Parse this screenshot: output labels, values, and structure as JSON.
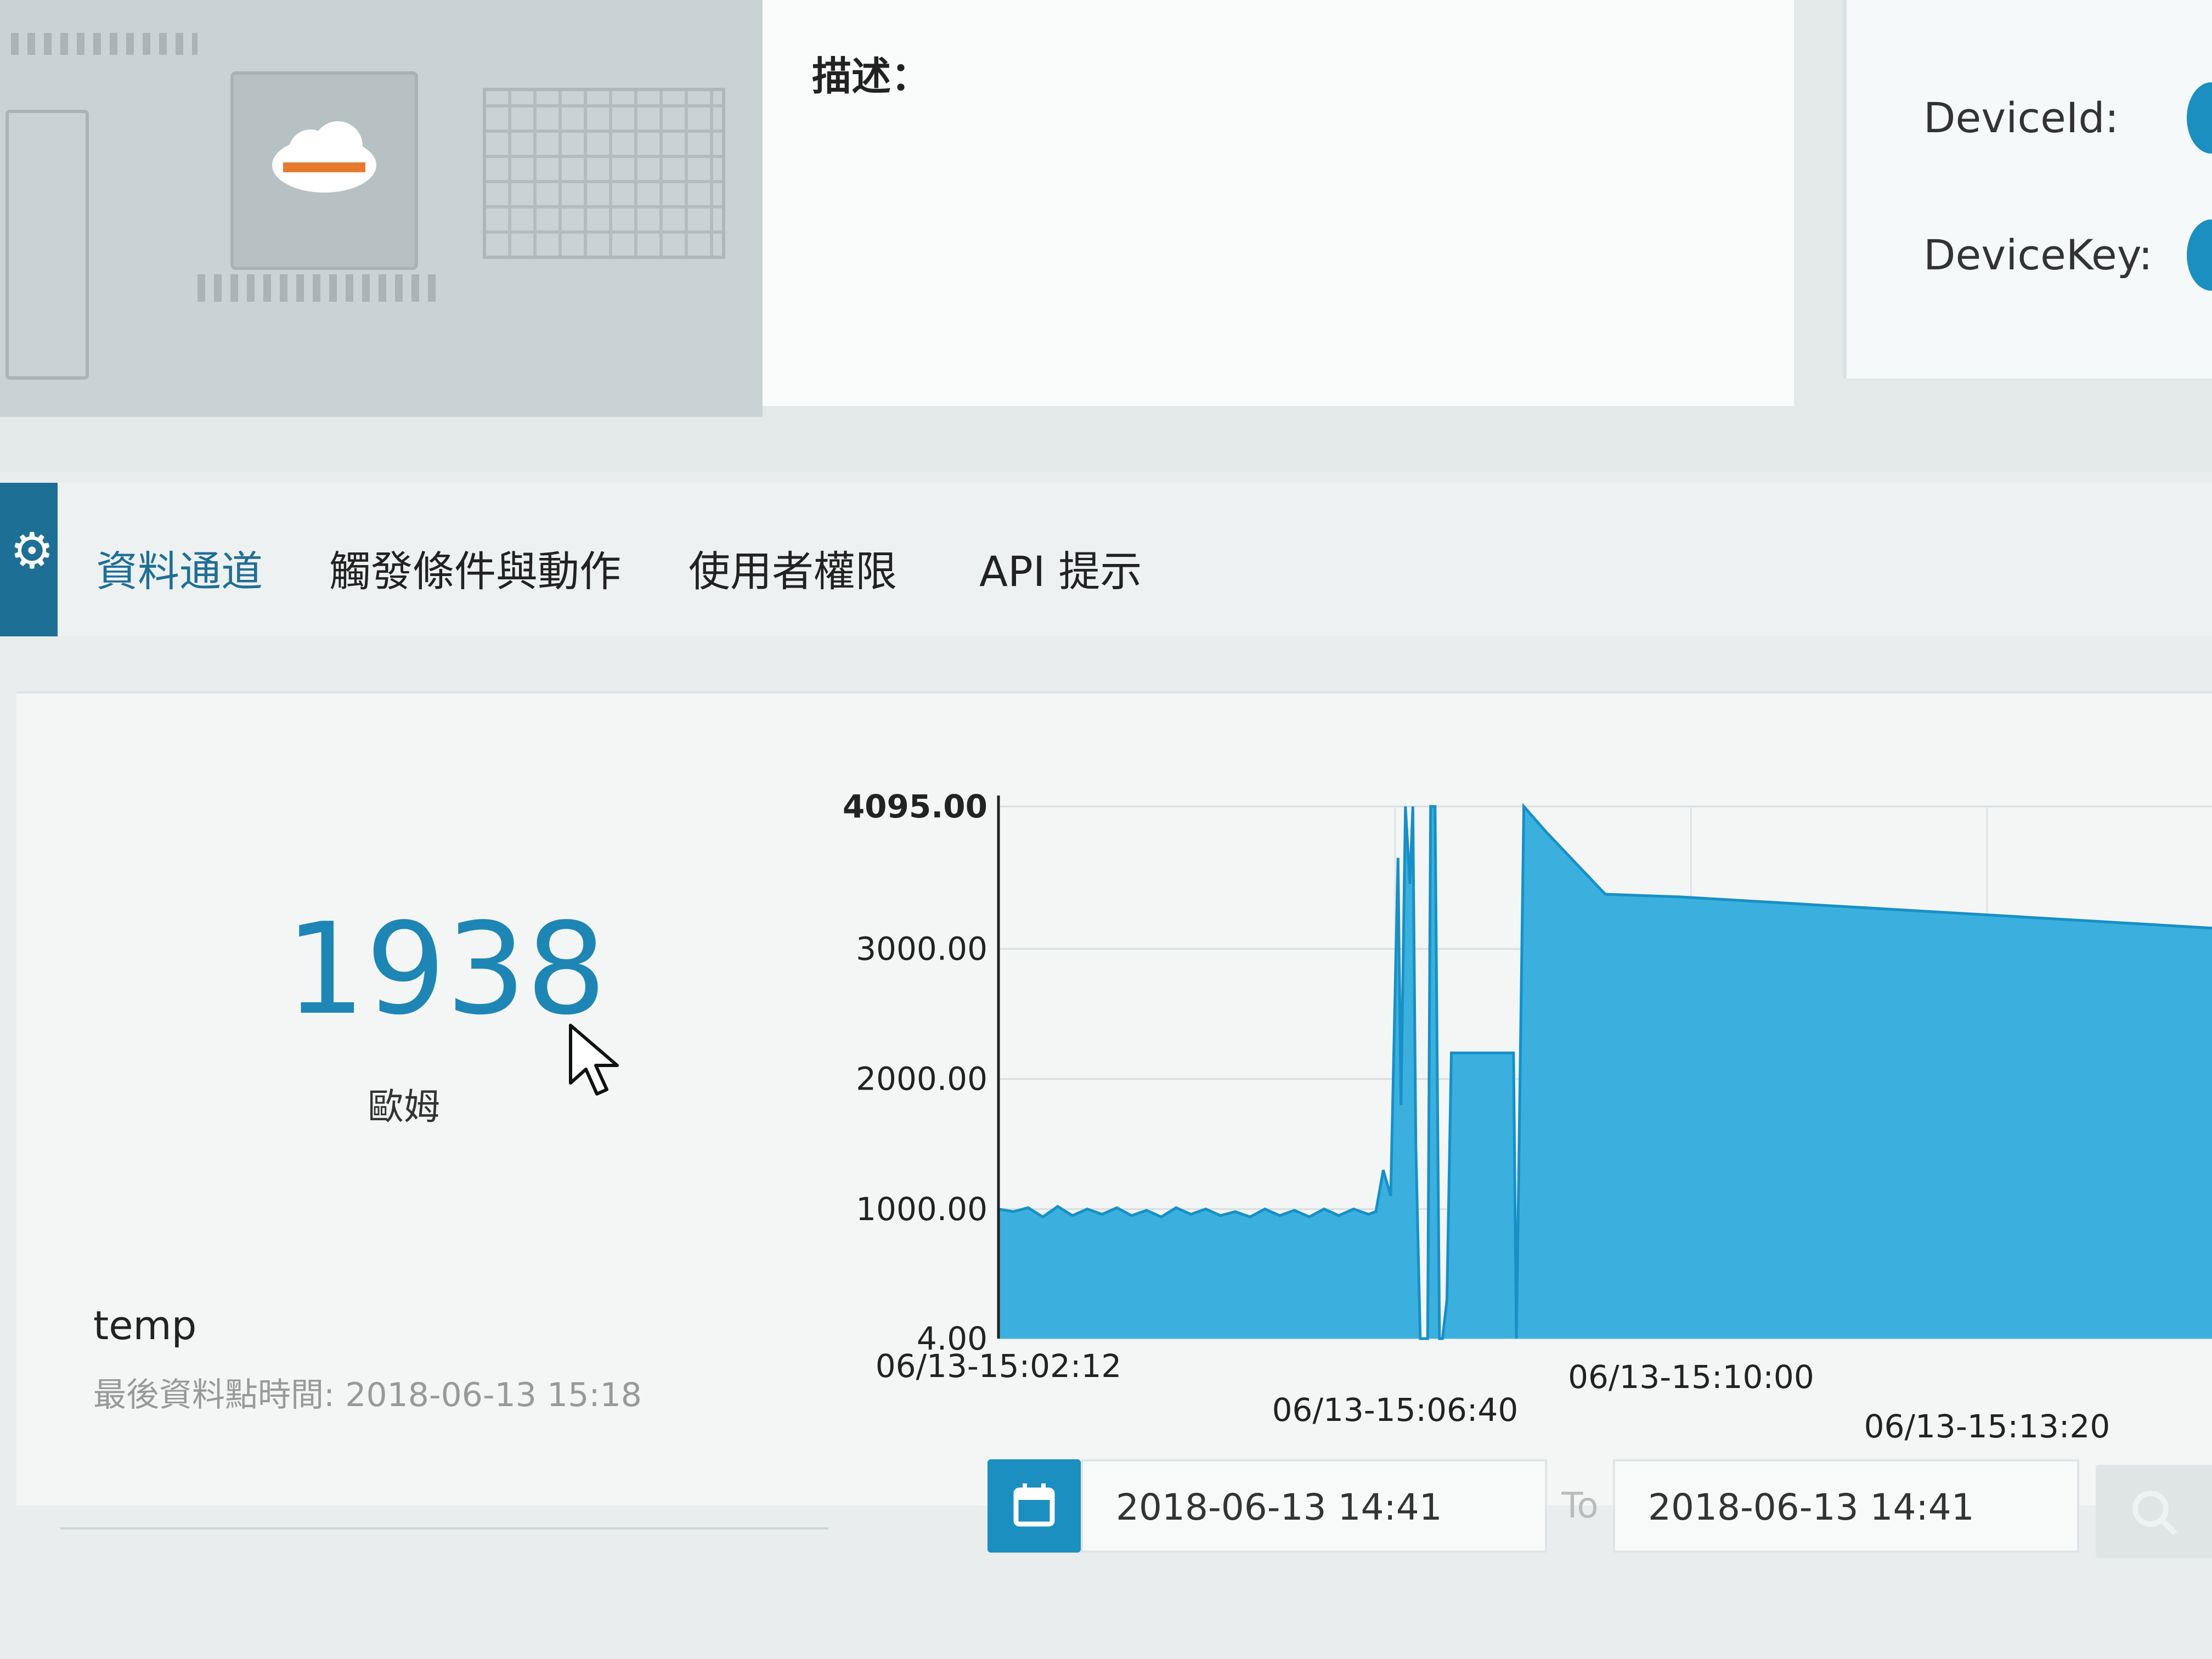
{
  "header": {
    "description_label": "描述：",
    "device_id_label": "DeviceId:",
    "device_key_label": "DeviceKey:"
  },
  "tabs": [
    {
      "label": "資料通道",
      "active": true
    },
    {
      "label": "觸發條件與動作",
      "active": false
    },
    {
      "label": "使用者權限",
      "active": false
    },
    {
      "label": "API 提示",
      "active": false
    }
  ],
  "channel": {
    "value": "1938",
    "unit": "歐姆",
    "name": "temp",
    "last_time": "最後資料點時間: 2018-06-13 15:18"
  },
  "date_range": {
    "from": "2018-06-13 14:41",
    "to_label": "To",
    "to": "2018-06-13 14:41"
  },
  "colors": {
    "accent": "#1b8fc0",
    "area_fill": "#3bb0de",
    "line": "#1690c6",
    "tab_active": "#1e6f95"
  },
  "chart_data": {
    "type": "area",
    "y_tick_labels": [
      "4095.00",
      "3000.00",
      "2000.00",
      "1000.00",
      "4.00"
    ],
    "x_tick_labels": [
      "06/13-15:02:12",
      "06/13-15:06:40",
      "06/13-15:10:00",
      "06/13-15:13:20"
    ],
    "ylim": [
      4,
      4095
    ],
    "xlim_seconds": [
      0,
      820
    ],
    "grid": true,
    "x": [
      0,
      10,
      20,
      30,
      40,
      50,
      60,
      70,
      80,
      90,
      100,
      110,
      120,
      130,
      140,
      150,
      160,
      170,
      180,
      190,
      200,
      210,
      220,
      230,
      240,
      250,
      255,
      260,
      265,
      270,
      272,
      275,
      278,
      280,
      282,
      285,
      290,
      292,
      295,
      298,
      300,
      303,
      306,
      310,
      330,
      348,
      350,
      355,
      370,
      410,
      460,
      520,
      580,
      640,
      700,
      760,
      820
    ],
    "values": [
      1000,
      980,
      1010,
      940,
      1020,
      950,
      1000,
      960,
      1010,
      950,
      990,
      940,
      1010,
      960,
      1000,
      950,
      980,
      940,
      1000,
      950,
      990,
      940,
      1000,
      950,
      1000,
      960,
      980,
      1300,
      1100,
      3700,
      1800,
      4095,
      3500,
      4095,
      1500,
      4,
      4,
      4095,
      4095,
      4,
      4,
      300,
      2200,
      2200,
      2200,
      2200,
      4,
      4095,
      3900,
      3420,
      3400,
      3360,
      3320,
      3280,
      3240,
      3200,
      3160
    ]
  }
}
